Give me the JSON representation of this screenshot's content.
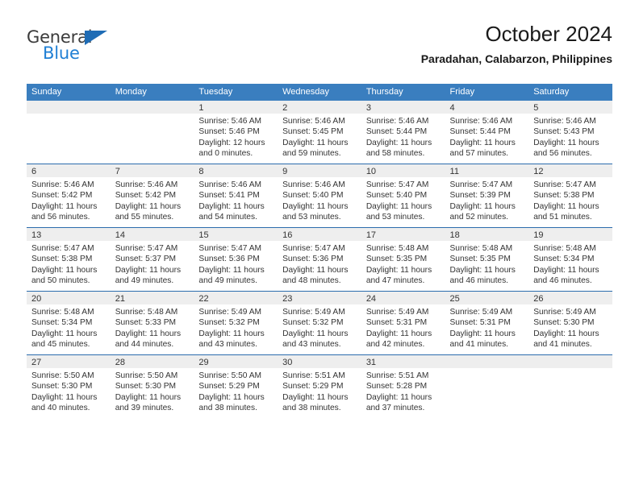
{
  "brand": {
    "name_top": "General",
    "name_bottom": "Blue",
    "triangle_icon": "triangle-logo-icon",
    "colors": {
      "blue": "#1f7fd4",
      "triangle": "#1f6cb5",
      "dark": "#3b3b3b"
    }
  },
  "header": {
    "title": "October 2024",
    "subtitle": "Paradahan, Calabarzon, Philippines"
  },
  "theme": {
    "header_bg": "#3a7ebf",
    "header_text": "#ffffff",
    "daynum_band_bg": "#eeeeee",
    "row_divider": "#2b6cad",
    "body_text": "#333333"
  },
  "calendar": {
    "weekday_headers": [
      "Sunday",
      "Monday",
      "Tuesday",
      "Wednesday",
      "Thursday",
      "Friday",
      "Saturday"
    ],
    "weeks": [
      [
        {
          "day": "",
          "empty": true,
          "sunrise": "",
          "sunset": "",
          "daylight1": "",
          "daylight2": ""
        },
        {
          "day": "",
          "empty": true,
          "sunrise": "",
          "sunset": "",
          "daylight1": "",
          "daylight2": ""
        },
        {
          "day": "1",
          "empty": false,
          "sunrise": "Sunrise: 5:46 AM",
          "sunset": "Sunset: 5:46 PM",
          "daylight1": "Daylight: 12 hours",
          "daylight2": "and 0 minutes."
        },
        {
          "day": "2",
          "empty": false,
          "sunrise": "Sunrise: 5:46 AM",
          "sunset": "Sunset: 5:45 PM",
          "daylight1": "Daylight: 11 hours",
          "daylight2": "and 59 minutes."
        },
        {
          "day": "3",
          "empty": false,
          "sunrise": "Sunrise: 5:46 AM",
          "sunset": "Sunset: 5:44 PM",
          "daylight1": "Daylight: 11 hours",
          "daylight2": "and 58 minutes."
        },
        {
          "day": "4",
          "empty": false,
          "sunrise": "Sunrise: 5:46 AM",
          "sunset": "Sunset: 5:44 PM",
          "daylight1": "Daylight: 11 hours",
          "daylight2": "and 57 minutes."
        },
        {
          "day": "5",
          "empty": false,
          "sunrise": "Sunrise: 5:46 AM",
          "sunset": "Sunset: 5:43 PM",
          "daylight1": "Daylight: 11 hours",
          "daylight2": "and 56 minutes."
        }
      ],
      [
        {
          "day": "6",
          "empty": false,
          "sunrise": "Sunrise: 5:46 AM",
          "sunset": "Sunset: 5:42 PM",
          "daylight1": "Daylight: 11 hours",
          "daylight2": "and 56 minutes."
        },
        {
          "day": "7",
          "empty": false,
          "sunrise": "Sunrise: 5:46 AM",
          "sunset": "Sunset: 5:42 PM",
          "daylight1": "Daylight: 11 hours",
          "daylight2": "and 55 minutes."
        },
        {
          "day": "8",
          "empty": false,
          "sunrise": "Sunrise: 5:46 AM",
          "sunset": "Sunset: 5:41 PM",
          "daylight1": "Daylight: 11 hours",
          "daylight2": "and 54 minutes."
        },
        {
          "day": "9",
          "empty": false,
          "sunrise": "Sunrise: 5:46 AM",
          "sunset": "Sunset: 5:40 PM",
          "daylight1": "Daylight: 11 hours",
          "daylight2": "and 53 minutes."
        },
        {
          "day": "10",
          "empty": false,
          "sunrise": "Sunrise: 5:47 AM",
          "sunset": "Sunset: 5:40 PM",
          "daylight1": "Daylight: 11 hours",
          "daylight2": "and 53 minutes."
        },
        {
          "day": "11",
          "empty": false,
          "sunrise": "Sunrise: 5:47 AM",
          "sunset": "Sunset: 5:39 PM",
          "daylight1": "Daylight: 11 hours",
          "daylight2": "and 52 minutes."
        },
        {
          "day": "12",
          "empty": false,
          "sunrise": "Sunrise: 5:47 AM",
          "sunset": "Sunset: 5:38 PM",
          "daylight1": "Daylight: 11 hours",
          "daylight2": "and 51 minutes."
        }
      ],
      [
        {
          "day": "13",
          "empty": false,
          "sunrise": "Sunrise: 5:47 AM",
          "sunset": "Sunset: 5:38 PM",
          "daylight1": "Daylight: 11 hours",
          "daylight2": "and 50 minutes."
        },
        {
          "day": "14",
          "empty": false,
          "sunrise": "Sunrise: 5:47 AM",
          "sunset": "Sunset: 5:37 PM",
          "daylight1": "Daylight: 11 hours",
          "daylight2": "and 49 minutes."
        },
        {
          "day": "15",
          "empty": false,
          "sunrise": "Sunrise: 5:47 AM",
          "sunset": "Sunset: 5:36 PM",
          "daylight1": "Daylight: 11 hours",
          "daylight2": "and 49 minutes."
        },
        {
          "day": "16",
          "empty": false,
          "sunrise": "Sunrise: 5:47 AM",
          "sunset": "Sunset: 5:36 PM",
          "daylight1": "Daylight: 11 hours",
          "daylight2": "and 48 minutes."
        },
        {
          "day": "17",
          "empty": false,
          "sunrise": "Sunrise: 5:48 AM",
          "sunset": "Sunset: 5:35 PM",
          "daylight1": "Daylight: 11 hours",
          "daylight2": "and 47 minutes."
        },
        {
          "day": "18",
          "empty": false,
          "sunrise": "Sunrise: 5:48 AM",
          "sunset": "Sunset: 5:35 PM",
          "daylight1": "Daylight: 11 hours",
          "daylight2": "and 46 minutes."
        },
        {
          "day": "19",
          "empty": false,
          "sunrise": "Sunrise: 5:48 AM",
          "sunset": "Sunset: 5:34 PM",
          "daylight1": "Daylight: 11 hours",
          "daylight2": "and 46 minutes."
        }
      ],
      [
        {
          "day": "20",
          "empty": false,
          "sunrise": "Sunrise: 5:48 AM",
          "sunset": "Sunset: 5:34 PM",
          "daylight1": "Daylight: 11 hours",
          "daylight2": "and 45 minutes."
        },
        {
          "day": "21",
          "empty": false,
          "sunrise": "Sunrise: 5:48 AM",
          "sunset": "Sunset: 5:33 PM",
          "daylight1": "Daylight: 11 hours",
          "daylight2": "and 44 minutes."
        },
        {
          "day": "22",
          "empty": false,
          "sunrise": "Sunrise: 5:49 AM",
          "sunset": "Sunset: 5:32 PM",
          "daylight1": "Daylight: 11 hours",
          "daylight2": "and 43 minutes."
        },
        {
          "day": "23",
          "empty": false,
          "sunrise": "Sunrise: 5:49 AM",
          "sunset": "Sunset: 5:32 PM",
          "daylight1": "Daylight: 11 hours",
          "daylight2": "and 43 minutes."
        },
        {
          "day": "24",
          "empty": false,
          "sunrise": "Sunrise: 5:49 AM",
          "sunset": "Sunset: 5:31 PM",
          "daylight1": "Daylight: 11 hours",
          "daylight2": "and 42 minutes."
        },
        {
          "day": "25",
          "empty": false,
          "sunrise": "Sunrise: 5:49 AM",
          "sunset": "Sunset: 5:31 PM",
          "daylight1": "Daylight: 11 hours",
          "daylight2": "and 41 minutes."
        },
        {
          "day": "26",
          "empty": false,
          "sunrise": "Sunrise: 5:49 AM",
          "sunset": "Sunset: 5:30 PM",
          "daylight1": "Daylight: 11 hours",
          "daylight2": "and 41 minutes."
        }
      ],
      [
        {
          "day": "27",
          "empty": false,
          "sunrise": "Sunrise: 5:50 AM",
          "sunset": "Sunset: 5:30 PM",
          "daylight1": "Daylight: 11 hours",
          "daylight2": "and 40 minutes."
        },
        {
          "day": "28",
          "empty": false,
          "sunrise": "Sunrise: 5:50 AM",
          "sunset": "Sunset: 5:30 PM",
          "daylight1": "Daylight: 11 hours",
          "daylight2": "and 39 minutes."
        },
        {
          "day": "29",
          "empty": false,
          "sunrise": "Sunrise: 5:50 AM",
          "sunset": "Sunset: 5:29 PM",
          "daylight1": "Daylight: 11 hours",
          "daylight2": "and 38 minutes."
        },
        {
          "day": "30",
          "empty": false,
          "sunrise": "Sunrise: 5:51 AM",
          "sunset": "Sunset: 5:29 PM",
          "daylight1": "Daylight: 11 hours",
          "daylight2": "and 38 minutes."
        },
        {
          "day": "31",
          "empty": false,
          "sunrise": "Sunrise: 5:51 AM",
          "sunset": "Sunset: 5:28 PM",
          "daylight1": "Daylight: 11 hours",
          "daylight2": "and 37 minutes."
        },
        {
          "day": "",
          "empty": true,
          "sunrise": "",
          "sunset": "",
          "daylight1": "",
          "daylight2": ""
        },
        {
          "day": "",
          "empty": true,
          "sunrise": "",
          "sunset": "",
          "daylight1": "",
          "daylight2": ""
        }
      ]
    ]
  }
}
